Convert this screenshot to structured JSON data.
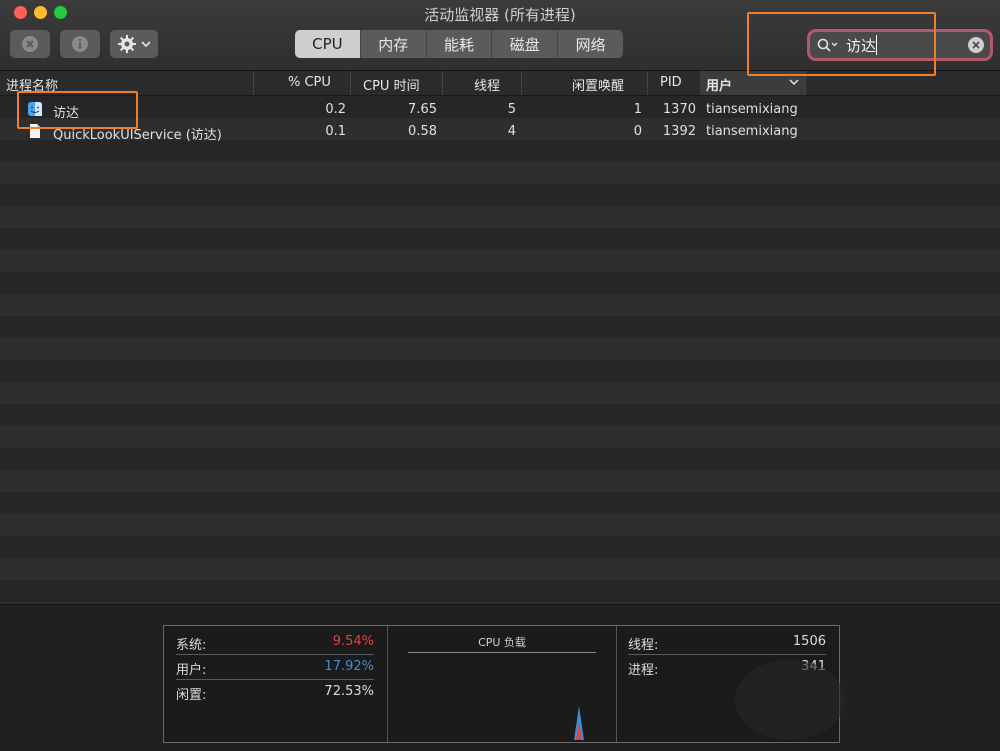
{
  "window": {
    "title": "活动监视器 (所有进程)"
  },
  "toolbar": {
    "stop_icon": "stop-process-icon",
    "info_icon": "info-icon",
    "gear_icon": "gear-icon",
    "tabs": [
      "CPU",
      "内存",
      "能耗",
      "磁盘",
      "网络"
    ],
    "selected_tab": "CPU",
    "search": {
      "value": "访达",
      "icon": "search-icon",
      "clear_icon": "clear-icon"
    }
  },
  "table": {
    "headers": [
      "进程名称",
      "% CPU",
      "CPU 时间",
      "线程",
      "闲置唤醒",
      "PID",
      "用户"
    ],
    "rows": [
      {
        "name": "访达",
        "cpu": "0.2",
        "cpu_time": "7.65",
        "threads": "5",
        "idle_wakeups": "1",
        "pid": "1370",
        "user": "tiansemixiang",
        "icon": "finder-icon"
      },
      {
        "name": "QuickLookUIService (访达)",
        "cpu": "0.1",
        "cpu_time": "0.58",
        "threads": "4",
        "idle_wakeups": "0",
        "pid": "1392",
        "user": "tiansemixiang",
        "icon": "document-icon"
      }
    ]
  },
  "stats": {
    "system_label": "系统:",
    "system_value": "9.54%",
    "system_color": "#e0443e",
    "user_label": "用户:",
    "user_value": "17.92%",
    "user_color": "#3b8fd8",
    "idle_label": "闲置:",
    "idle_value": "72.53%",
    "cpu_load_title": "CPU 负载",
    "threads_label": "线程:",
    "threads_value": "1506",
    "processes_label": "进程:",
    "processes_value": "341"
  }
}
